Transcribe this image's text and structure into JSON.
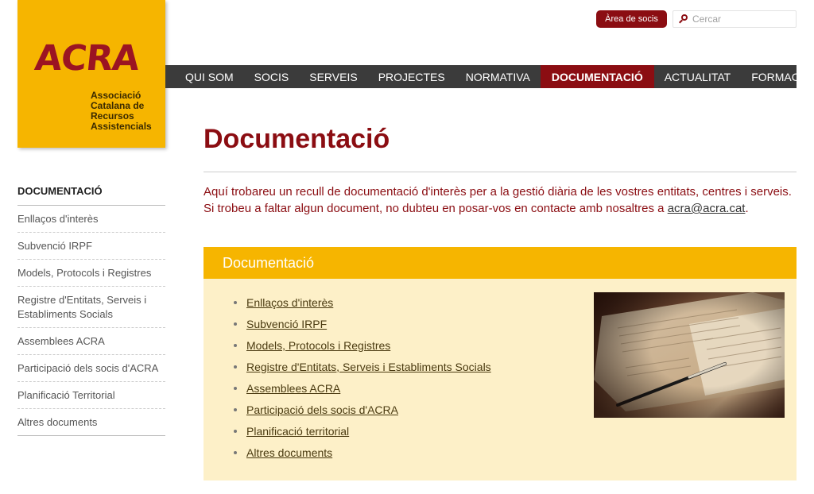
{
  "logo": {
    "word": "ACRA",
    "subtitle_lines": [
      "Associació",
      "Catalana de",
      "Recursos",
      "Assistencials"
    ]
  },
  "header": {
    "area_button": "Àrea de socis",
    "search_placeholder": "Cercar"
  },
  "nav": {
    "items": [
      "QUI SOM",
      "SOCIS",
      "SERVEIS",
      "PROJECTES",
      "NORMATIVA",
      "DOCUMENTACIÓ",
      "ACTUALITAT",
      "FORMACIÓ"
    ],
    "active": "DOCUMENTACIÓ"
  },
  "sidebar": {
    "title": "DOCUMENTACIÓ",
    "items": [
      "Enllaços d'interès",
      "Subvenció IRPF",
      "Models, Protocols i Registres",
      "Registre d'Entitats, Serveis i Establiments Socials",
      "Assemblees ACRA",
      "Participació dels socis d'ACRA",
      "Planificació Territorial",
      "Altres documents"
    ]
  },
  "main": {
    "title": "Documentació",
    "intro_text": "Aquí trobareu un recull de documentació d'interès per a la gestió diària de les vostres entitats, centres i serveis. Si trobeu a faltar algun document, no dubteu en posar-vos en contacte amb nosaltres a ",
    "intro_email": "acra@acra.cat",
    "intro_end": "."
  },
  "panel": {
    "title": "Documentació",
    "links": [
      "Enllaços d'interès",
      "Subvenció IRPF",
      "Models, Protocols i Registres",
      "Registre d'Entitats, Serveis i Establiments Socials",
      "Assemblees ACRA",
      "Participació dels socis d'ACRA",
      "Planificació territorial",
      "Altres documents"
    ]
  },
  "colors": {
    "brand_red": "#8b0d12",
    "brand_yellow": "#f6b500",
    "nav_dark": "#3b3b3b",
    "panel_bg": "#fdf0c8"
  }
}
